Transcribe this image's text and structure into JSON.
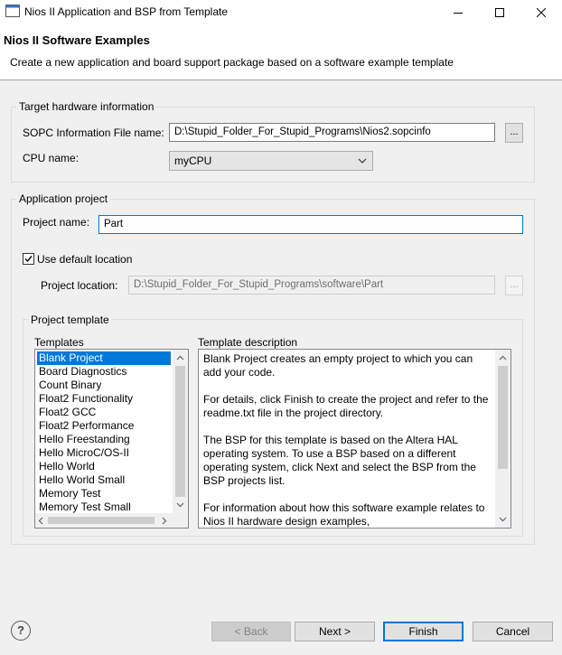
{
  "window": {
    "title": "Nios II Application and BSP from Template",
    "icon": "app-window-icon"
  },
  "banner": {
    "title": "Nios II Software Examples",
    "description": "Create a new application and board support package based on a software example template"
  },
  "target_hardware": {
    "group_label": "Target hardware information",
    "sopc_label": "SOPC Information File name:",
    "sopc_value": "D:\\Stupid_Folder_For_Stupid_Programs\\Nios2.sopcinfo",
    "browse_label": "...",
    "cpu_label": "CPU name:",
    "cpu_value": "myCPU"
  },
  "application_project": {
    "group_label": "Application project",
    "project_name_label": "Project name:",
    "project_name_value": "Part",
    "use_default_label": "Use default location",
    "use_default_checked": true,
    "location_label": "Project location:",
    "location_value": "D:\\Stupid_Folder_For_Stupid_Programs\\software\\Part",
    "location_browse_label": "..."
  },
  "project_template": {
    "group_label": "Project template",
    "templates_label": "Templates",
    "templates": [
      "Blank Project",
      "Board Diagnostics",
      "Count Binary",
      "Float2 Functionality",
      "Float2 GCC",
      "Float2 Performance",
      "Hello Freestanding",
      "Hello MicroC/OS-II",
      "Hello World",
      "Hello World Small",
      "Memory Test",
      "Memory Test Small"
    ],
    "selected_index": 0,
    "description_label": "Template description",
    "description_paragraphs": [
      [
        "Blank Project creates an empty project to which you can",
        "add your code."
      ],
      [
        "For details, click Finish to create the project and refer to the",
        "readme.txt file in the project directory."
      ],
      [
        "The BSP for this template is based on the Altera HAL",
        "operating system. To use a BSP based on a different",
        "operating system, click Next and select the BSP from the",
        "BSP projects list."
      ],
      [
        "For information about how this software example relates to",
        "Nios II hardware design examples,"
      ]
    ]
  },
  "footer": {
    "help_label": "?",
    "back_label": "< Back",
    "next_label": "Next >",
    "finish_label": "Finish",
    "cancel_label": "Cancel"
  }
}
